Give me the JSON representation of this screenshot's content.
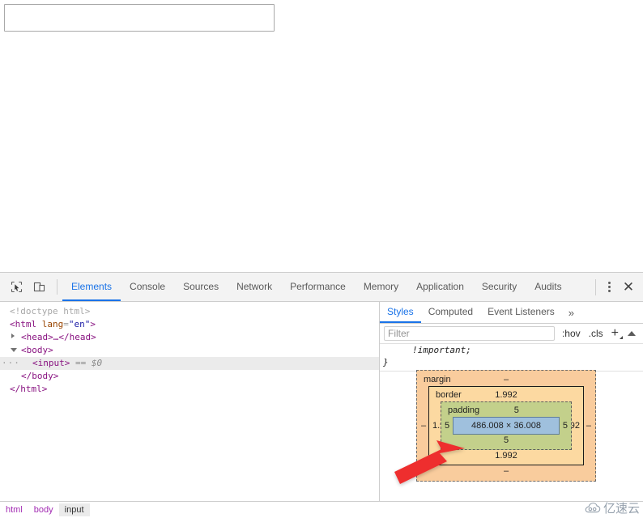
{
  "page": {
    "input": {
      "value": "",
      "placeholder": ""
    }
  },
  "devtools": {
    "toolbar": {
      "inspect_icon": "inspect-cursor-icon",
      "device_icon": "device-toolbar-icon",
      "menu_icon": "kebab-menu-icon",
      "close_icon": "close-icon",
      "close_glyph": "✕"
    },
    "tabs": [
      {
        "label": "Elements",
        "active": true
      },
      {
        "label": "Console",
        "active": false
      },
      {
        "label": "Sources",
        "active": false
      },
      {
        "label": "Network",
        "active": false
      },
      {
        "label": "Performance",
        "active": false
      },
      {
        "label": "Memory",
        "active": false
      },
      {
        "label": "Application",
        "active": false
      },
      {
        "label": "Security",
        "active": false
      },
      {
        "label": "Audits",
        "active": false
      }
    ],
    "dom": {
      "doctype": "<!doctype html>",
      "html_open_tag": "<html",
      "html_attr_name": "lang",
      "html_attr_eq": "=",
      "html_attr_value": "\"en\"",
      "html_open_close": ">",
      "head_line": "<head>…</head>",
      "body_open": "<body>",
      "input_tag": "<input>",
      "input_selection": "== $0",
      "body_close": "</body>",
      "html_close": "</html>",
      "more_dots": "···"
    },
    "styles": {
      "tabs": [
        {
          "label": "Styles",
          "active": true
        },
        {
          "label": "Computed",
          "active": false
        },
        {
          "label": "Event Listeners",
          "active": false
        }
      ],
      "more_label": "»",
      "filter": {
        "value": "",
        "placeholder": "Filter"
      },
      "hov_label": ":hov",
      "cls_label": ".cls",
      "new_rule_label": "+",
      "scroll_caret": "caret-up-icon",
      "css_snippet_important": "!important;",
      "css_snippet_brace": "}"
    },
    "box_model": {
      "margin_label": "margin",
      "margin_top": "–",
      "margin_right": "–",
      "margin_bottom": "–",
      "margin_left": "–",
      "border_label": "border",
      "border_top": "1.992",
      "border_right": "1.992",
      "border_bottom": "1.992",
      "border_left": "1.992",
      "padding_label": "padding",
      "padding_top": "5",
      "padding_right": "5",
      "padding_bottom": "5",
      "padding_left": "5",
      "content_size": "486.008 × 36.008",
      "colors": {
        "margin": "#f9cc9d",
        "border": "#fcd9a1",
        "padding": "#c3d08b",
        "content": "#9fc0dd"
      }
    },
    "breadcrumb": [
      {
        "label": "html",
        "selected": false
      },
      {
        "label": "body",
        "selected": false
      },
      {
        "label": "input",
        "selected": true
      }
    ]
  },
  "annotation": {
    "arrow_color": "#ee2d2d",
    "arrow_name": "red-pointer-arrow"
  },
  "watermark": {
    "text": "亿速云",
    "icon": "cloud-logo-icon"
  }
}
